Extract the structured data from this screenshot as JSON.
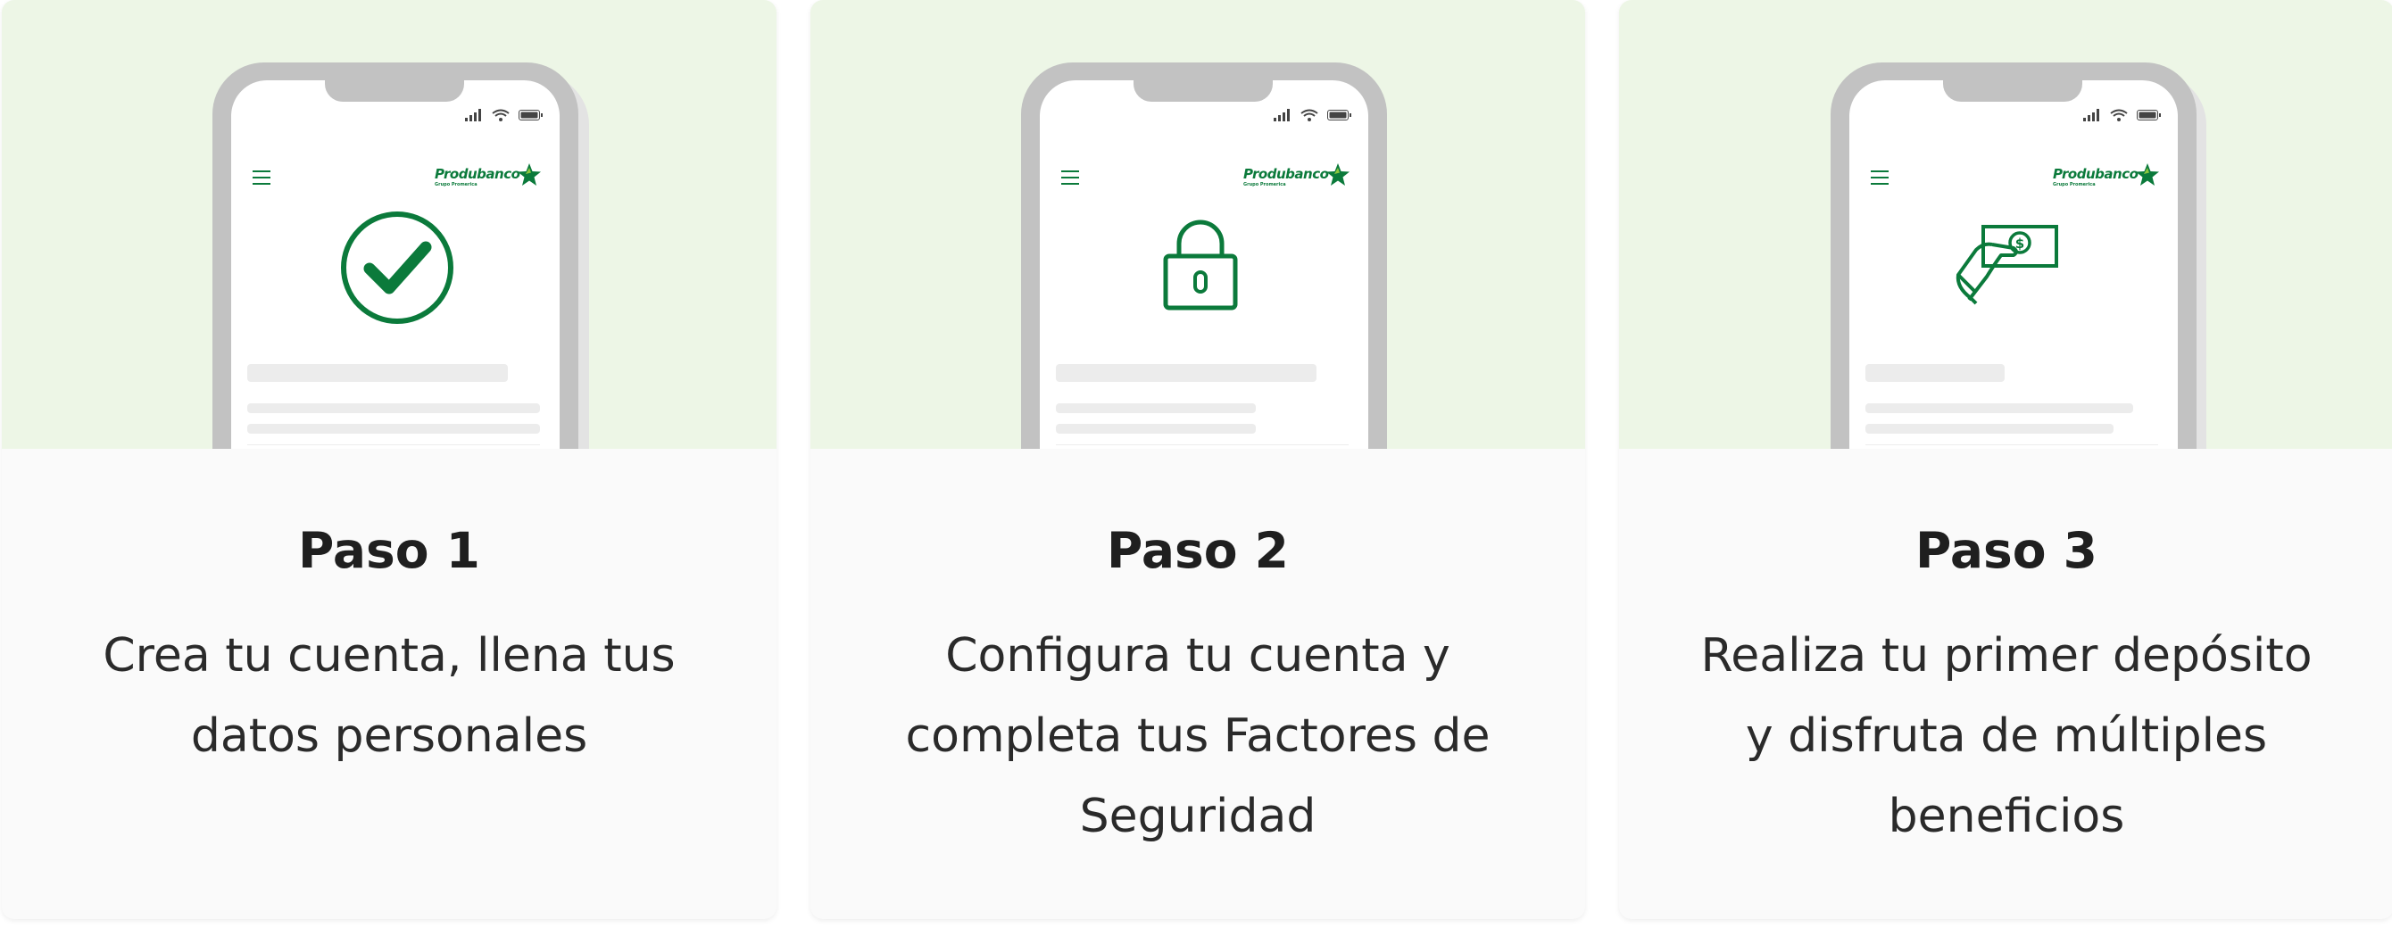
{
  "brand": {
    "name": "Produbanco",
    "tagline": "Grupo Promerica",
    "color": "#0b7a3b",
    "hero_bg": "#edf6e6"
  },
  "cards": [
    {
      "title": "Paso 1",
      "description": "Crea tu cuenta, llena tus datos personales",
      "icon": "check-circle-icon"
    },
    {
      "title": "Paso 2",
      "description": "Configura tu cuenta y completa tus Factores de Seguridad",
      "icon": "lock-icon"
    },
    {
      "title": "Paso 3",
      "description": "Realiza tu primer depósito y disfruta de múltiples beneficios",
      "icon": "hand-money-icon"
    }
  ]
}
